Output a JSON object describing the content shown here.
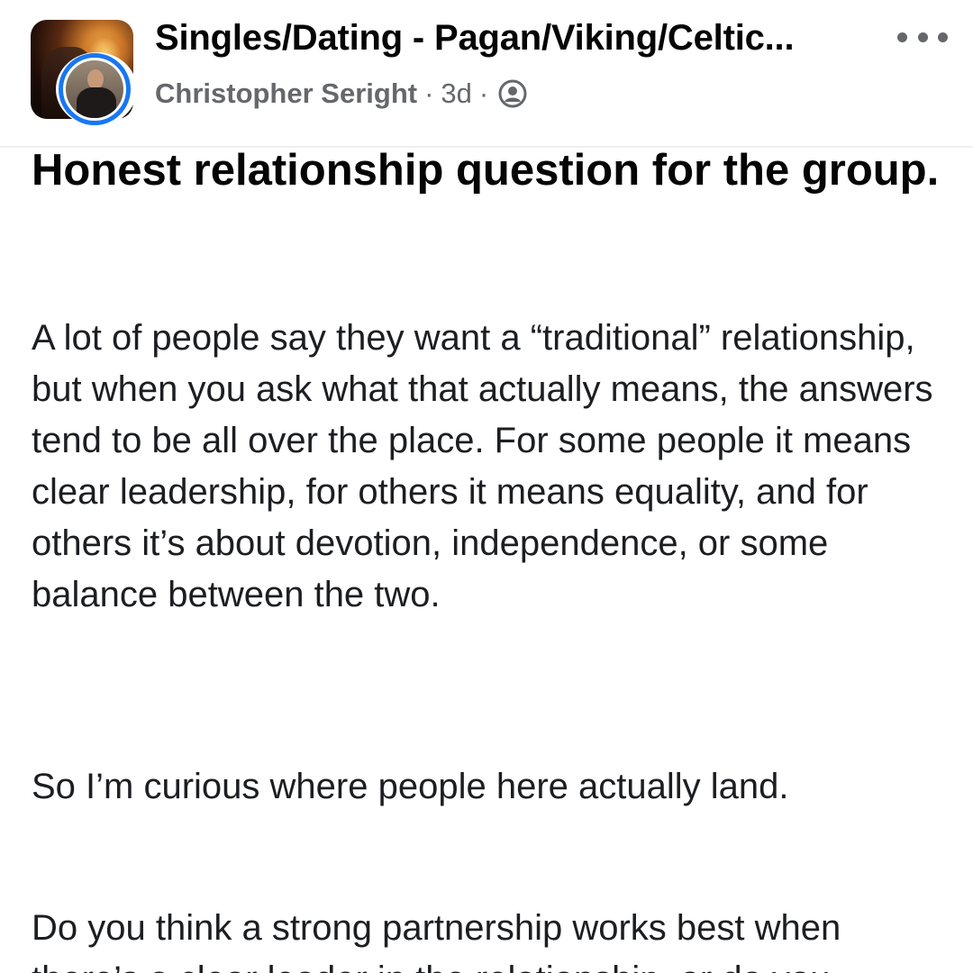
{
  "post_header": {
    "group_name": "Singles/Dating - Pagan/Viking/Celtic...",
    "author_name": "Christopher Seright",
    "separator": "·",
    "time_ago": "3d",
    "audience_icon": "members-audience-icon",
    "more_icon": "more-options-icon",
    "ring_color": "#1877f2"
  },
  "post": {
    "title": "Honest relationship question for the group.",
    "paragraphs": [
      "A lot of people say they want a “traditional” relationship, but when you ask what that actually means, the answers tend to be all over the place. For some people it means clear leadership, for others it means equality, and for others it’s about devotion, independence, or some balance between the two.",
      "So I’m curious where people here actually land.",
      "Do you think a strong partnership works best when there’s a clear leader in the relationship, or do you"
    ]
  }
}
